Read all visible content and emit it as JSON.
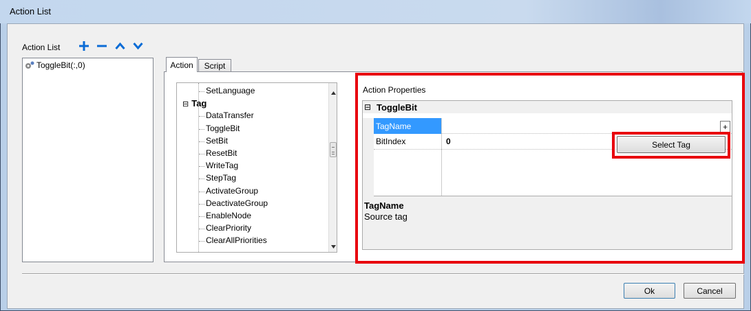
{
  "window": {
    "title": "Action List"
  },
  "action_list": {
    "label": "Action List",
    "items": [
      {
        "label": "ToggleBit(:,0)"
      }
    ]
  },
  "tabs": [
    {
      "label": "Action"
    },
    {
      "label": "Script"
    }
  ],
  "tree": {
    "items": [
      {
        "label": "SetLanguage",
        "level": 2
      },
      {
        "label": "Tag",
        "level": 1
      },
      {
        "label": "DataTransfer",
        "level": 2
      },
      {
        "label": "ToggleBit",
        "level": 2
      },
      {
        "label": "SetBit",
        "level": 2
      },
      {
        "label": "ResetBit",
        "level": 2
      },
      {
        "label": "WriteTag",
        "level": 2
      },
      {
        "label": "StepTag",
        "level": 2
      },
      {
        "label": "ActivateGroup",
        "level": 2
      },
      {
        "label": "DeactivateGroup",
        "level": 2
      },
      {
        "label": "EnableNode",
        "level": 2
      },
      {
        "label": "ClearPriority",
        "level": 2
      },
      {
        "label": "ClearAllPriorities",
        "level": 2
      }
    ],
    "expander": "⊟"
  },
  "properties": {
    "title": "Action Properties",
    "group": "ToggleBit",
    "collapse_symbol": "⊟",
    "rows": [
      {
        "name": "TagName",
        "value": ""
      },
      {
        "name": "BitIndex",
        "value": "0"
      }
    ],
    "plus_label": "+",
    "select_tag_label": "Select Tag",
    "description_title": "TagName",
    "description_text": "Source tag"
  },
  "buttons": {
    "ok": "Ok",
    "cancel": "Cancel"
  },
  "colors": {
    "accent": "#0b6cd6",
    "highlight_red": "#e8000b",
    "selection": "#3399ff"
  }
}
